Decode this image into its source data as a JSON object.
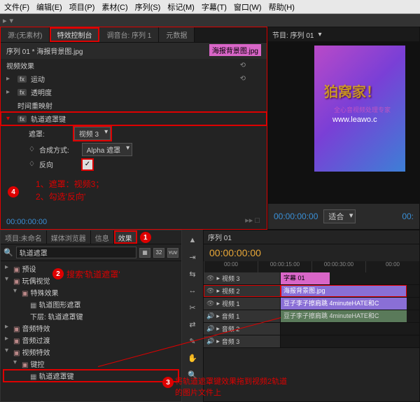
{
  "menubar": [
    "文件(F)",
    "编辑(E)",
    "项目(P)",
    "素材(C)",
    "序列(S)",
    "标记(M)",
    "字幕(T)",
    "窗口(W)",
    "帮助(H)"
  ],
  "top_tabs": {
    "source": "源:(无素材)",
    "effect_controls": "特效控制台",
    "mixer": "调音台: 序列 1",
    "meta": "元数据"
  },
  "ec": {
    "header": "序列 01 * 海报背景图.jpg",
    "clip_name": "海报背景图.jpg",
    "video_effects": "视频效果",
    "rows": {
      "motion": "运动",
      "opacity": "透明度",
      "time_remap": "时间重映射",
      "track_matte": "轨道遮罩键",
      "matte_label": "遮罩:",
      "matte_value": "视频 3",
      "composite_label": "合成方式:",
      "composite_value": "Alpha 遮罩",
      "reverse_label": "反向"
    },
    "annot1": "1、遮罩：视频3；",
    "annot2": "2、勾选'反向'",
    "timecode": "00:00:00:00"
  },
  "program": {
    "tab": "节目: 序列 01",
    "frame_text1": "狛窝家！",
    "frame_text2": "全心音视频处理专家",
    "frame_text3": "www.leawo.c",
    "tc": "00:00:00:00",
    "fit": "适合",
    "total": "00:"
  },
  "project_tabs": [
    "项目:未命名",
    "媒体浏览器",
    "信息",
    "效果"
  ],
  "search": {
    "placeholder": "",
    "value": "轨道遮罩"
  },
  "tree": {
    "presets": "预设",
    "distort": "玩偶视觉",
    "special": "特殊效果",
    "matte_effect": "轨道图形遮罩",
    "sub_matte": "下层: 轨道遮罩键",
    "audio_fx": "音频特效",
    "audio_trans": "音频过渡",
    "video_fx": "视频特效",
    "keying": "键控",
    "track_matte_key": "轨道遮罩键"
  },
  "annot_search": "搜索'轨道遮罩'",
  "annot_drag": "将轨道遮罩键效果拖到视频2轨道\n的图片文件上",
  "timeline": {
    "seq": "序列 01",
    "tc": "00:00:00:00",
    "ruler": [
      "00:00",
      "00:00:15:00",
      "00:00:30:00",
      "00:00"
    ],
    "tracks": {
      "v3": "视频 3",
      "v3_clip": "字幕 01",
      "v2": "视频 2",
      "v2_clip": "海报背景图.jpg",
      "v1": "视频 1",
      "v1_clip": "豆子李子擦肩跳 4minuteHATE和C",
      "a1": "音频 1",
      "a1_clip": "豆子李子擦肩跳 4minuteHATE和C",
      "a2": "音频 2",
      "a3": "音频 3"
    }
  }
}
